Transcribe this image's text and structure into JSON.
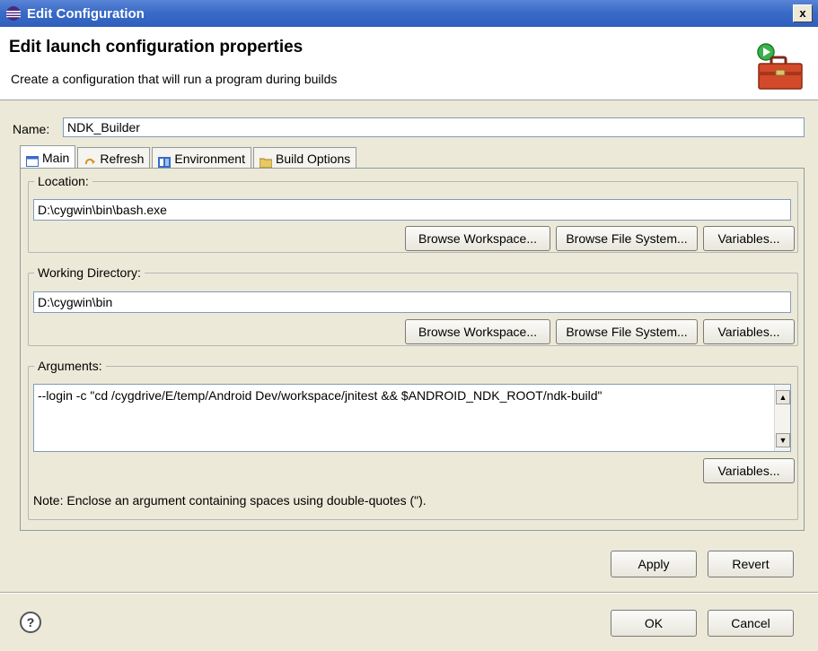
{
  "window": {
    "title": "Edit Configuration",
    "close_label": "x"
  },
  "header": {
    "title": "Edit launch configuration properties",
    "subtitle": "Create a configuration that will run a program during builds"
  },
  "name": {
    "label": "Name:",
    "value": "NDK_Builder"
  },
  "tabs": [
    {
      "label": "Main"
    },
    {
      "label": "Refresh"
    },
    {
      "label": "Environment"
    },
    {
      "label": "Build Options"
    }
  ],
  "location": {
    "legend": "Location:",
    "value": "D:\\cygwin\\bin\\bash.exe",
    "browse_workspace": "Browse Workspace...",
    "browse_fs": "Browse File System...",
    "variables": "Variables..."
  },
  "workdir": {
    "legend": "Working Directory:",
    "value": "D:\\cygwin\\bin",
    "browse_workspace": "Browse Workspace...",
    "browse_fs": "Browse File System...",
    "variables": "Variables..."
  },
  "arguments": {
    "legend": "Arguments:",
    "value": "--login -c \"cd /cygdrive/E/temp/Android Dev/workspace/jnitest && $ANDROID_NDK_ROOT/ndk-build\"",
    "variables": "Variables...",
    "note": "Note: Enclose an argument containing spaces using double-quotes (\")."
  },
  "actions": {
    "apply": "Apply",
    "revert": "Revert",
    "ok": "OK",
    "cancel": "Cancel",
    "help": "?"
  },
  "colors": {
    "titlebar": "#3a6bc8",
    "dialog_bg": "#ece9d8"
  }
}
